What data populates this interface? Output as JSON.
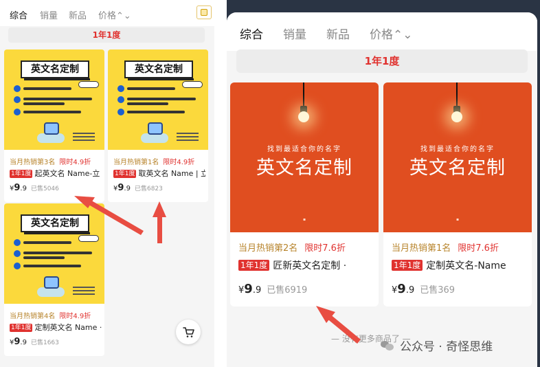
{
  "left": {
    "tabs": [
      {
        "label": "综合",
        "active": true
      },
      {
        "label": "销量",
        "active": false
      },
      {
        "label": "新品",
        "active": false
      },
      {
        "label": "价格⌃⌄",
        "active": false
      }
    ],
    "filter_chip": "1年1度",
    "image_title": "英文名定制",
    "products": [
      {
        "hot": "当月热销第3名",
        "discount": "限时4.9折",
        "tag": "1年1度",
        "name": "起英文名 Name-立",
        "price_symbol": "¥",
        "price_int": "9",
        "price_dec": ".9",
        "sold": "已售5046"
      },
      {
        "hot": "当月热销第1名",
        "discount": "限时4.9折",
        "tag": "1年1度",
        "name": "取英文名 Name | 立",
        "price_symbol": "¥",
        "price_int": "9",
        "price_dec": ".9",
        "sold": "已售6823"
      },
      {
        "hot": "当月热销第4名",
        "discount": "限时4.9折",
        "tag": "1年1度",
        "name": "定制英文名 Name ·",
        "price_symbol": "¥",
        "price_int": "9",
        "price_dec": ".9",
        "sold": "已售1663"
      }
    ],
    "cart_icon": "cart-icon"
  },
  "right": {
    "tabs": [
      {
        "label": "综合",
        "active": true
      },
      {
        "label": "销量",
        "active": false
      },
      {
        "label": "新品",
        "active": false
      },
      {
        "label": "价格⌃⌄",
        "active": false
      }
    ],
    "filter_chip": "1年1度",
    "products": [
      {
        "image_sub": "找到最适合你的名字",
        "image_main": "英文名定制",
        "hot": "当月热销第2名",
        "discount": "限时7.6折",
        "tag": "1年1度",
        "name": "匠新英文名定制 ·",
        "price_symbol": "¥",
        "price_int": "9",
        "price_dec": ".9",
        "sold": "已售6919"
      },
      {
        "image_sub": "找到最适合你的名字",
        "image_main": "英文名定制",
        "hot": "当月热销第1名",
        "discount": "限时7.6折",
        "tag": "1年1度",
        "name": "定制英文名-Name",
        "price_symbol": "¥",
        "price_int": "9",
        "price_dec": ".9",
        "sold": "已售369"
      }
    ],
    "end_text": "— 没有更多商品了 —",
    "watermark": "公众号 · 奇怪思维"
  },
  "colors": {
    "accent_red": "#e0322f",
    "gold": "#b7832a",
    "poster_orange": "#e04e20",
    "poster_yellow": "#fbd93c"
  }
}
